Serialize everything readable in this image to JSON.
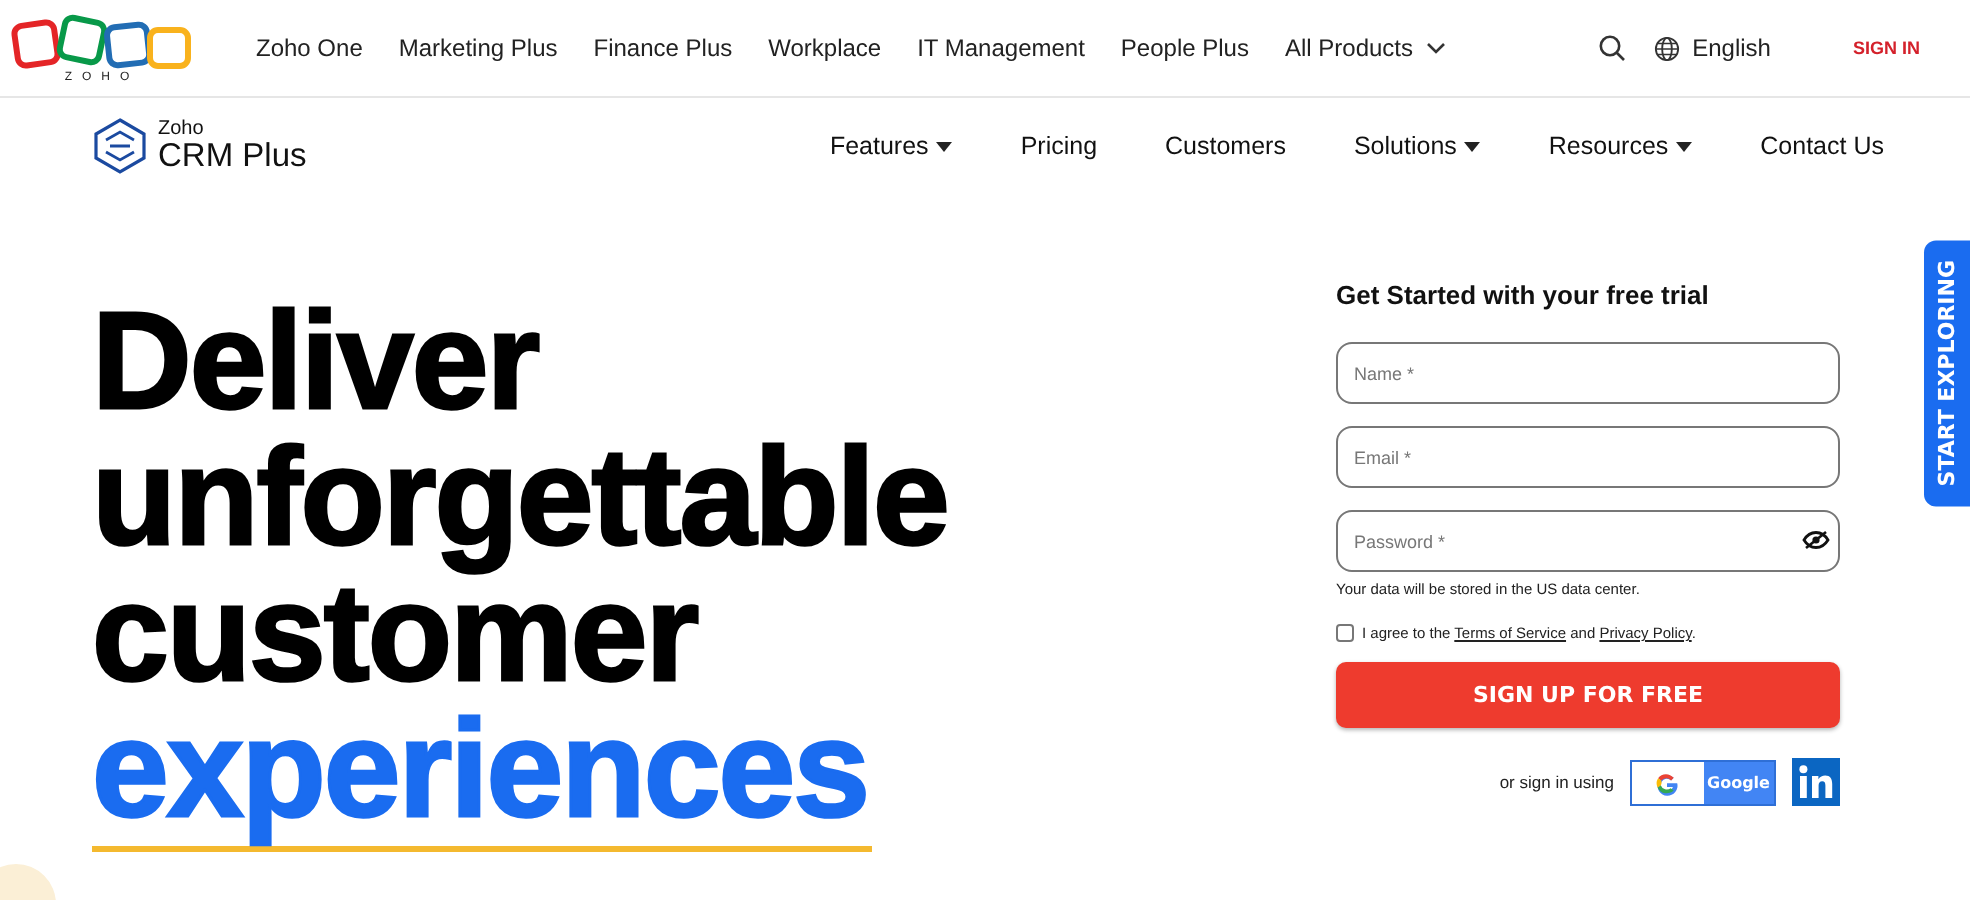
{
  "top_bar": {
    "logo": "ZOHO",
    "menu": [
      {
        "label": "Zoho One",
        "has_dropdown": false
      },
      {
        "label": "Marketing Plus",
        "has_dropdown": false
      },
      {
        "label": "Finance Plus",
        "has_dropdown": false
      },
      {
        "label": "Workplace",
        "has_dropdown": false
      },
      {
        "label": "IT Management",
        "has_dropdown": false
      },
      {
        "label": "People Plus",
        "has_dropdown": false
      },
      {
        "label": "All Products",
        "has_dropdown": true
      }
    ],
    "language": "English",
    "sign_in": "SIGN IN"
  },
  "product_nav": {
    "brand": {
      "company": "Zoho",
      "product": "CRM Plus"
    },
    "items": [
      {
        "label": "Features",
        "has_dropdown": true
      },
      {
        "label": "Pricing",
        "has_dropdown": false
      },
      {
        "label": "Customers",
        "has_dropdown": false
      },
      {
        "label": "Solutions",
        "has_dropdown": true
      },
      {
        "label": "Resources",
        "has_dropdown": true
      },
      {
        "label": "Contact Us",
        "has_dropdown": false
      }
    ]
  },
  "headline": {
    "lines": [
      {
        "text": "Deliver",
        "highlighted": false
      },
      {
        "text": "unforgettable",
        "highlighted": false
      },
      {
        "text": "customer",
        "highlighted": false
      },
      {
        "text": "experiences",
        "highlighted": true
      }
    ]
  },
  "signup_form": {
    "title": "Get Started with your free trial",
    "fields": [
      {
        "placeholder": "Name *",
        "kind": "text"
      },
      {
        "placeholder": "Email *",
        "kind": "text"
      },
      {
        "placeholder": "Password *",
        "kind": "password"
      }
    ],
    "note": "Your data will be stored in the US data center.",
    "consent": {
      "checked": false,
      "parts": [
        {
          "kind": "text",
          "text": "I agree to the "
        },
        {
          "kind": "link",
          "text": "Terms of Service"
        },
        {
          "kind": "text",
          "text": " and "
        },
        {
          "kind": "link",
          "text": "Privacy Policy"
        },
        {
          "kind": "text",
          "text": "."
        }
      ]
    },
    "submit": "SIGN UP FOR FREE",
    "social_label": "or sign in using",
    "google": "Google"
  },
  "side_tab": "START EXPLORING"
}
